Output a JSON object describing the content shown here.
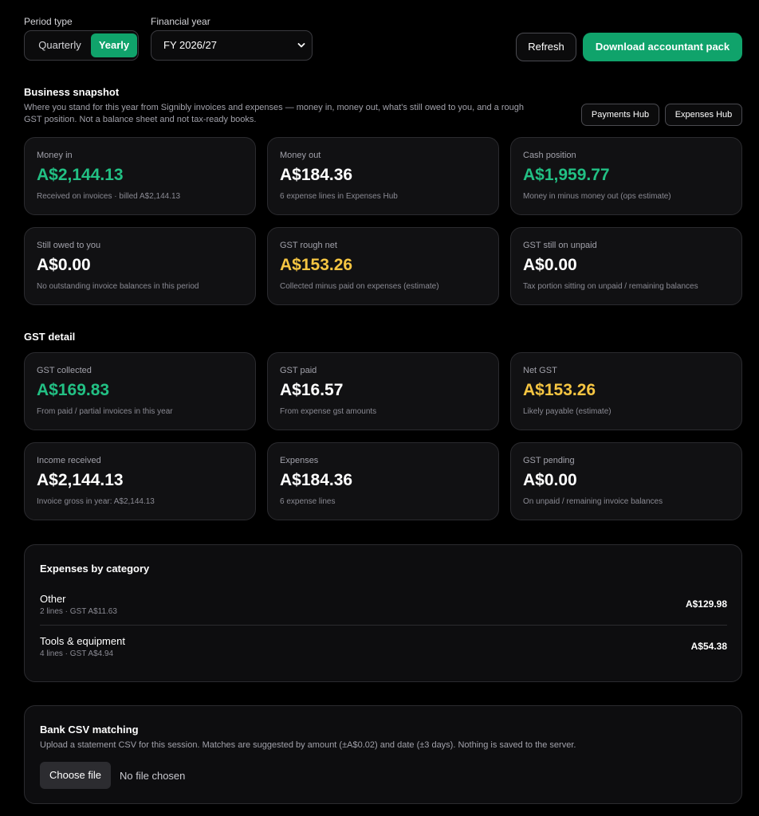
{
  "controls": {
    "period_type_label": "Period type",
    "period_options": [
      "Quarterly",
      "Yearly"
    ],
    "period_selected": "Yearly",
    "financial_year_label": "Financial year",
    "financial_year_value": "FY 2026/27",
    "refresh_label": "Refresh",
    "download_label": "Download accountant pack"
  },
  "snapshot": {
    "title": "Business snapshot",
    "description": "Where you stand for this year from Signibly invoices and expenses — money in, money out, what's still owed to you, and a rough GST position. Not a balance sheet and not tax-ready books.",
    "payments_hub_label": "Payments Hub",
    "expenses_hub_label": "Expenses Hub",
    "cards": [
      {
        "label": "Money in",
        "value": "A$2,144.13",
        "sub": "Received on invoices · billed A$2,144.13",
        "tone": "green"
      },
      {
        "label": "Money out",
        "value": "A$184.36",
        "sub": "6 expense lines in Expenses Hub",
        "tone": "white"
      },
      {
        "label": "Cash position",
        "value": "A$1,959.77",
        "sub": "Money in minus money out (ops estimate)",
        "tone": "green"
      },
      {
        "label": "Still owed to you",
        "value": "A$0.00",
        "sub": "No outstanding invoice balances in this period",
        "tone": "white"
      },
      {
        "label": "GST rough net",
        "value": "A$153.26",
        "sub": "Collected minus paid on expenses (estimate)",
        "tone": "yellow"
      },
      {
        "label": "GST still on unpaid",
        "value": "A$0.00",
        "sub": "Tax portion sitting on unpaid / remaining balances",
        "tone": "white"
      }
    ]
  },
  "gst": {
    "title": "GST detail",
    "cards": [
      {
        "label": "GST collected",
        "value": "A$169.83",
        "sub": "From paid / partial invoices in this year",
        "tone": "green"
      },
      {
        "label": "GST paid",
        "value": "A$16.57",
        "sub": "From expense gst amounts",
        "tone": "white"
      },
      {
        "label": "Net GST",
        "value": "A$153.26",
        "sub": "Likely payable (estimate)",
        "tone": "yellow"
      },
      {
        "label": "Income received",
        "value": "A$2,144.13",
        "sub": "Invoice gross in year: A$2,144.13",
        "tone": "white"
      },
      {
        "label": "Expenses",
        "value": "A$184.36",
        "sub": "6 expense lines",
        "tone": "white"
      },
      {
        "label": "GST pending",
        "value": "A$0.00",
        "sub": "On unpaid / remaining invoice balances",
        "tone": "white"
      }
    ]
  },
  "expenses_by_category": {
    "title": "Expenses by category",
    "rows": [
      {
        "name": "Other",
        "meta": "2 lines · GST A$11.63",
        "amount": "A$129.98"
      },
      {
        "name": "Tools & equipment",
        "meta": "4 lines · GST A$4.94",
        "amount": "A$54.38"
      }
    ]
  },
  "bank_csv": {
    "title": "Bank CSV matching",
    "description": "Upload a statement CSV for this session. Matches are suggested by amount (±A$0.02) and date (±3 days). Nothing is saved to the server.",
    "choose_file_label": "Choose file",
    "file_status": "No file chosen"
  },
  "colors": {
    "accent": "#10a36b",
    "positive": "#22c084",
    "warning": "#f5c542",
    "background": "#000000",
    "card": "#111113"
  }
}
